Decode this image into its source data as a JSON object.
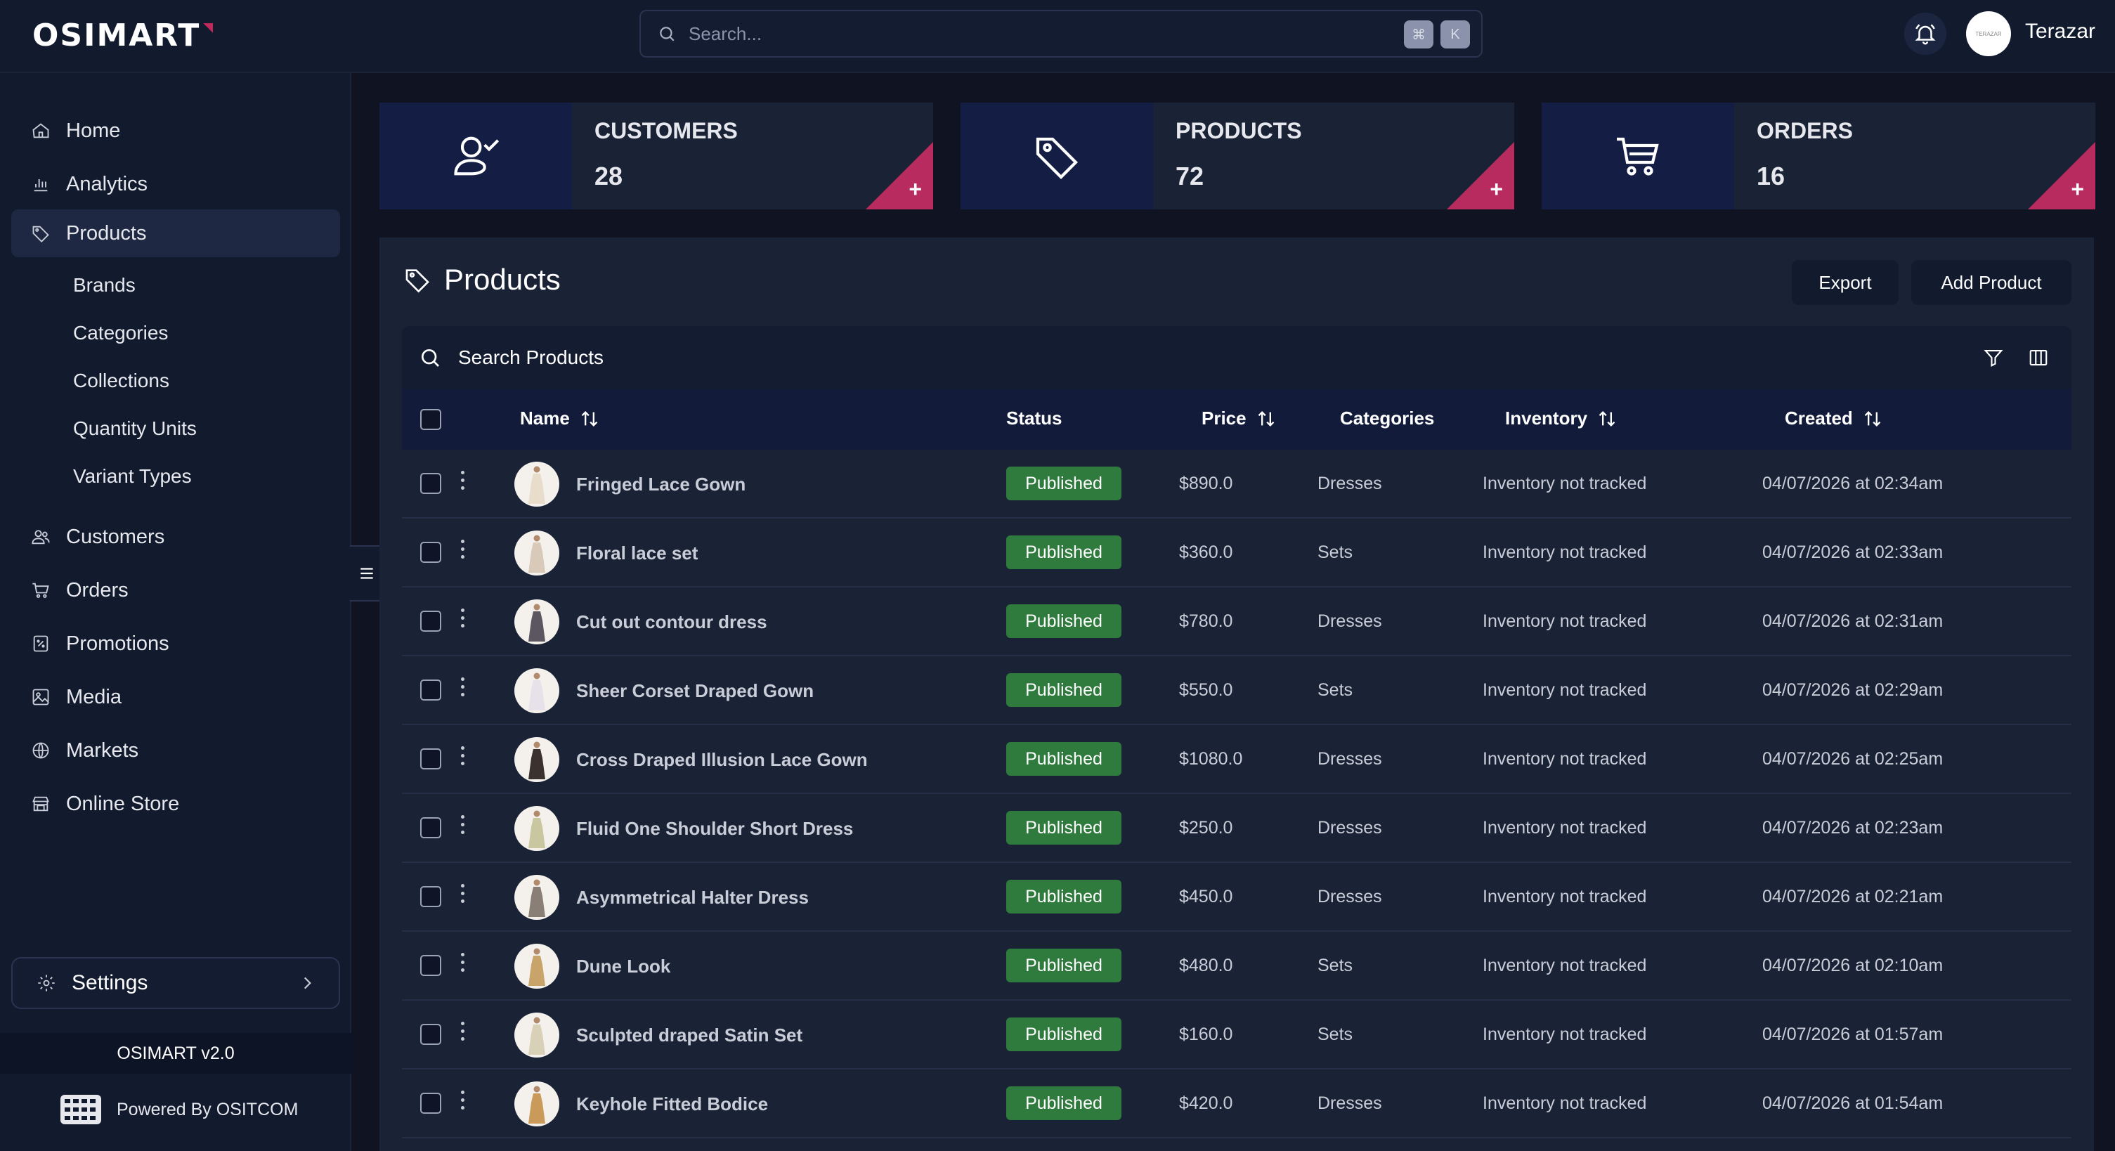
{
  "header": {
    "logo": "OSIMART",
    "search_placeholder": "Search...",
    "shortcut_keys": [
      "⌘",
      "K"
    ],
    "avatar_text": "TERAZAR",
    "username": "Terazar"
  },
  "sidebar": {
    "items": [
      {
        "label": "Home",
        "icon": "home-icon"
      },
      {
        "label": "Analytics",
        "icon": "bar-chart-icon"
      },
      {
        "label": "Products",
        "icon": "tag-icon",
        "active": true
      },
      {
        "label": "Customers",
        "icon": "users-icon"
      },
      {
        "label": "Orders",
        "icon": "cart-icon"
      },
      {
        "label": "Promotions",
        "icon": "percent-icon"
      },
      {
        "label": "Media",
        "icon": "image-icon"
      },
      {
        "label": "Markets",
        "icon": "globe-icon"
      },
      {
        "label": "Online Store",
        "icon": "store-icon"
      }
    ],
    "subitems": [
      "Brands",
      "Categories",
      "Collections",
      "Quantity Units",
      "Variant Types"
    ],
    "settings_label": "Settings",
    "version": "OSIMART v2.0",
    "powered_by": "Powered By OSITCOM"
  },
  "stats": [
    {
      "title": "CUSTOMERS",
      "value": "28",
      "icon": "user-check-icon"
    },
    {
      "title": "PRODUCTS",
      "value": "72",
      "icon": "tag-icon"
    },
    {
      "title": "ORDERS",
      "value": "16",
      "icon": "cart-icon"
    }
  ],
  "panel": {
    "title": "Products",
    "export_label": "Export",
    "add_label": "Add Product",
    "search_placeholder": "Search Products"
  },
  "table": {
    "columns": [
      "Name",
      "Status",
      "Price",
      "Categories",
      "Inventory",
      "Created"
    ],
    "rows": [
      {
        "name": "Fringed Lace Gown",
        "status": "Published",
        "price": "$890.0",
        "category": "Dresses",
        "inventory": "Inventory not tracked",
        "created": "04/07/2026 at 02:34am"
      },
      {
        "name": "Floral lace set",
        "status": "Published",
        "price": "$360.0",
        "category": "Sets",
        "inventory": "Inventory not tracked",
        "created": "04/07/2026 at 02:33am"
      },
      {
        "name": "Cut out contour dress",
        "status": "Published",
        "price": "$780.0",
        "category": "Dresses",
        "inventory": "Inventory not tracked",
        "created": "04/07/2026 at 02:31am"
      },
      {
        "name": "Sheer Corset Draped Gown",
        "status": "Published",
        "price": "$550.0",
        "category": "Sets",
        "inventory": "Inventory not tracked",
        "created": "04/07/2026 at 02:29am"
      },
      {
        "name": "Cross Draped Illusion Lace Gown",
        "status": "Published",
        "price": "$1080.0",
        "category": "Dresses",
        "inventory": "Inventory not tracked",
        "created": "04/07/2026 at 02:25am"
      },
      {
        "name": "Fluid One Shoulder Short Dress",
        "status": "Published",
        "price": "$250.0",
        "category": "Dresses",
        "inventory": "Inventory not tracked",
        "created": "04/07/2026 at 02:23am"
      },
      {
        "name": "Asymmetrical Halter Dress",
        "status": "Published",
        "price": "$450.0",
        "category": "Dresses",
        "inventory": "Inventory not tracked",
        "created": "04/07/2026 at 02:21am"
      },
      {
        "name": "Dune Look",
        "status": "Published",
        "price": "$480.0",
        "category": "Sets",
        "inventory": "Inventory not tracked",
        "created": "04/07/2026 at 02:10am"
      },
      {
        "name": "Sculpted draped Satin Set",
        "status": "Published",
        "price": "$160.0",
        "category": "Sets",
        "inventory": "Inventory not tracked",
        "created": "04/07/2026 at 01:57am"
      },
      {
        "name": "Keyhole Fitted Bodice",
        "status": "Published",
        "price": "$420.0",
        "category": "Dresses",
        "inventory": "Inventory not tracked",
        "created": "04/07/2026 at 01:54am"
      }
    ]
  },
  "colors": {
    "accent": "#b82b5e",
    "published": "#2f7a3d",
    "icon_box": "#141e45"
  }
}
